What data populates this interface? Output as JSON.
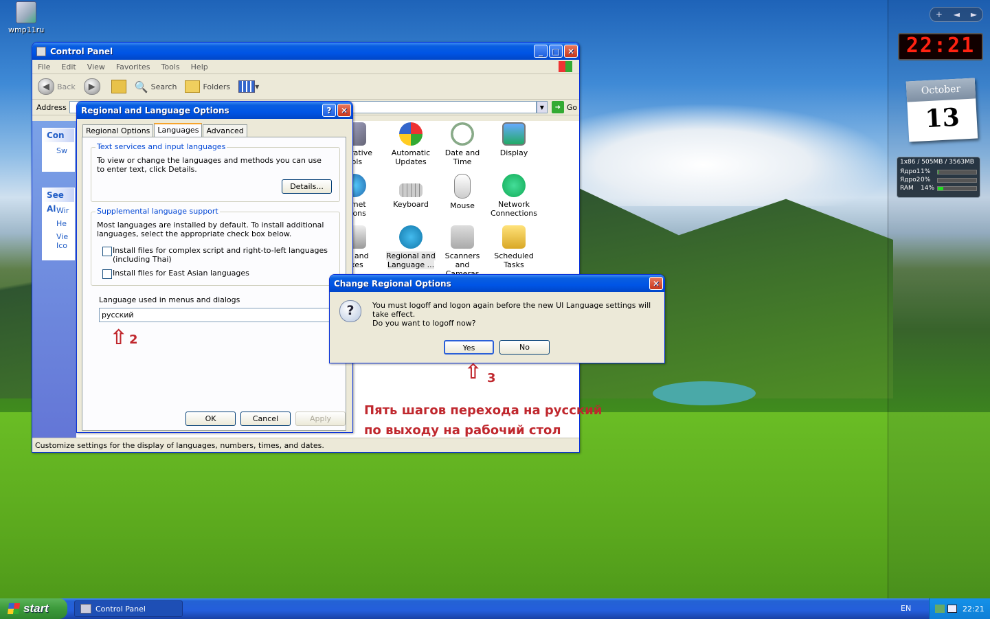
{
  "desktop": {
    "icon_label": "wmp11ru",
    "annotation_text_line1": "Пять шагов перехода на русский",
    "annotation_text_line2": "по выходу на рабочий стол",
    "step2": "2",
    "step3": "3"
  },
  "sidebar": {
    "add": "+",
    "prev": "◄",
    "next": "►",
    "clock": "22:21",
    "cal_month": "October",
    "cal_day": "13",
    "cpu_header": "1x86 / 505MB / 3563MB",
    "cpu_rows": [
      {
        "label": "Ядро1",
        "pct": "1%",
        "value": 0.01
      },
      {
        "label": "Ядро2",
        "pct": "0%",
        "value": 0.0
      },
      {
        "label": "RAM",
        "pct": "14%",
        "value": 0.14
      }
    ]
  },
  "control_panel": {
    "title": "Control Panel",
    "menu": [
      "File",
      "Edit",
      "View",
      "Favorites",
      "Tools",
      "Help"
    ],
    "toolbar": {
      "back": "Back",
      "search": "Search",
      "folders": "Folders"
    },
    "address_label": "Address",
    "go": "Go",
    "task_head_1": "Con",
    "task_item_1": "Sw",
    "see_also": "See Al",
    "see_items": [
      "Wir",
      "He",
      "Vie",
      "Ico"
    ],
    "icons": [
      {
        "label": "Administrative Tools",
        "shown": "nistrative\nools"
      },
      {
        "label": "Automatic Updates",
        "shown": "Automatic\nUpdates"
      },
      {
        "label": "Date and Time",
        "shown": "Date and Time"
      },
      {
        "label": "Display",
        "shown": "Display"
      },
      {
        "label": "Internet Options",
        "shown": "ternet\nptions"
      },
      {
        "label": "Keyboard",
        "shown": "Keyboard"
      },
      {
        "label": "Mouse",
        "shown": "Mouse"
      },
      {
        "label": "Network Connections",
        "shown": "Network\nConnections"
      },
      {
        "label": "Printers and Faxes",
        "shown": "ers and\naxes"
      },
      {
        "label": "Regional and Language ...",
        "shown": "Regional and\nLanguage ..."
      },
      {
        "label": "Scanners and Cameras",
        "shown": "Scanners and\nCameras"
      },
      {
        "label": "Scheduled Tasks",
        "shown": "Scheduled\nTasks"
      }
    ],
    "status": "Customize settings for the display of languages, numbers, times, and dates."
  },
  "regional_dialog": {
    "title": "Regional and Language Options",
    "tabs": [
      "Regional Options",
      "Languages",
      "Advanced"
    ],
    "group1_legend": "Text services and input languages",
    "group1_text": "To view or change the languages and methods you can use to enter text, click Details.",
    "details_btn": "Details...",
    "group2_legend": "Supplemental language support",
    "group2_text": "Most languages are installed by default. To install additional languages, select the appropriate check box below.",
    "check1": "Install files for complex script and right-to-left languages (including Thai)",
    "check2": "Install files for East Asian languages",
    "lang_label": "Language used in menus and dialogs",
    "lang_value": "русский",
    "ok": "OK",
    "cancel": "Cancel",
    "apply": "Apply"
  },
  "change_dialog": {
    "title": "Change Regional Options",
    "message": "You must logoff and logon again before the new UI Language settings will take effect.",
    "question": "Do you want to logoff now?",
    "yes": "Yes",
    "no": "No"
  },
  "taskbar": {
    "start": "start",
    "task": "Control Panel",
    "lang": "EN",
    "time": "22:21"
  }
}
